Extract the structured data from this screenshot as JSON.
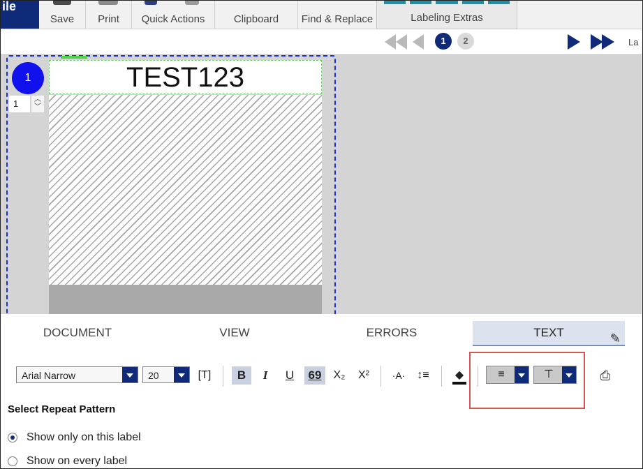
{
  "ribbon": {
    "file_label": "ile",
    "groups": [
      {
        "label": "Save"
      },
      {
        "label": "Print"
      },
      {
        "label": "Quick Actions"
      },
      {
        "label": "Clipboard"
      },
      {
        "label": "Find & Replace"
      },
      {
        "label": "Labeling Extras"
      }
    ]
  },
  "pagination": {
    "pages": [
      "1",
      "2"
    ],
    "active_page": "1",
    "right_cut_label": "La"
  },
  "label_editor": {
    "label_number": "1",
    "copies": "1",
    "text_object": "TEST123"
  },
  "tabs": [
    {
      "label": "DOCUMENT",
      "active": false
    },
    {
      "label": "VIEW",
      "active": false
    },
    {
      "label": "ERRORS",
      "active": false
    },
    {
      "label": "TEXT",
      "active": true
    }
  ],
  "formatting": {
    "font": "Arial Narrow",
    "size": "20",
    "bold": "B",
    "italic": "I",
    "underline": "U",
    "barcode_text": "69",
    "subscript": "X₂",
    "superscript": "X²",
    "highlight_color": "#d9534f",
    "accent_color": "#0e2a78"
  },
  "repeat_pattern": {
    "title": "Select Repeat Pattern",
    "options": [
      {
        "label": "Show only on this label",
        "selected": true
      },
      {
        "label": "Show on every label",
        "selected": false
      }
    ]
  }
}
